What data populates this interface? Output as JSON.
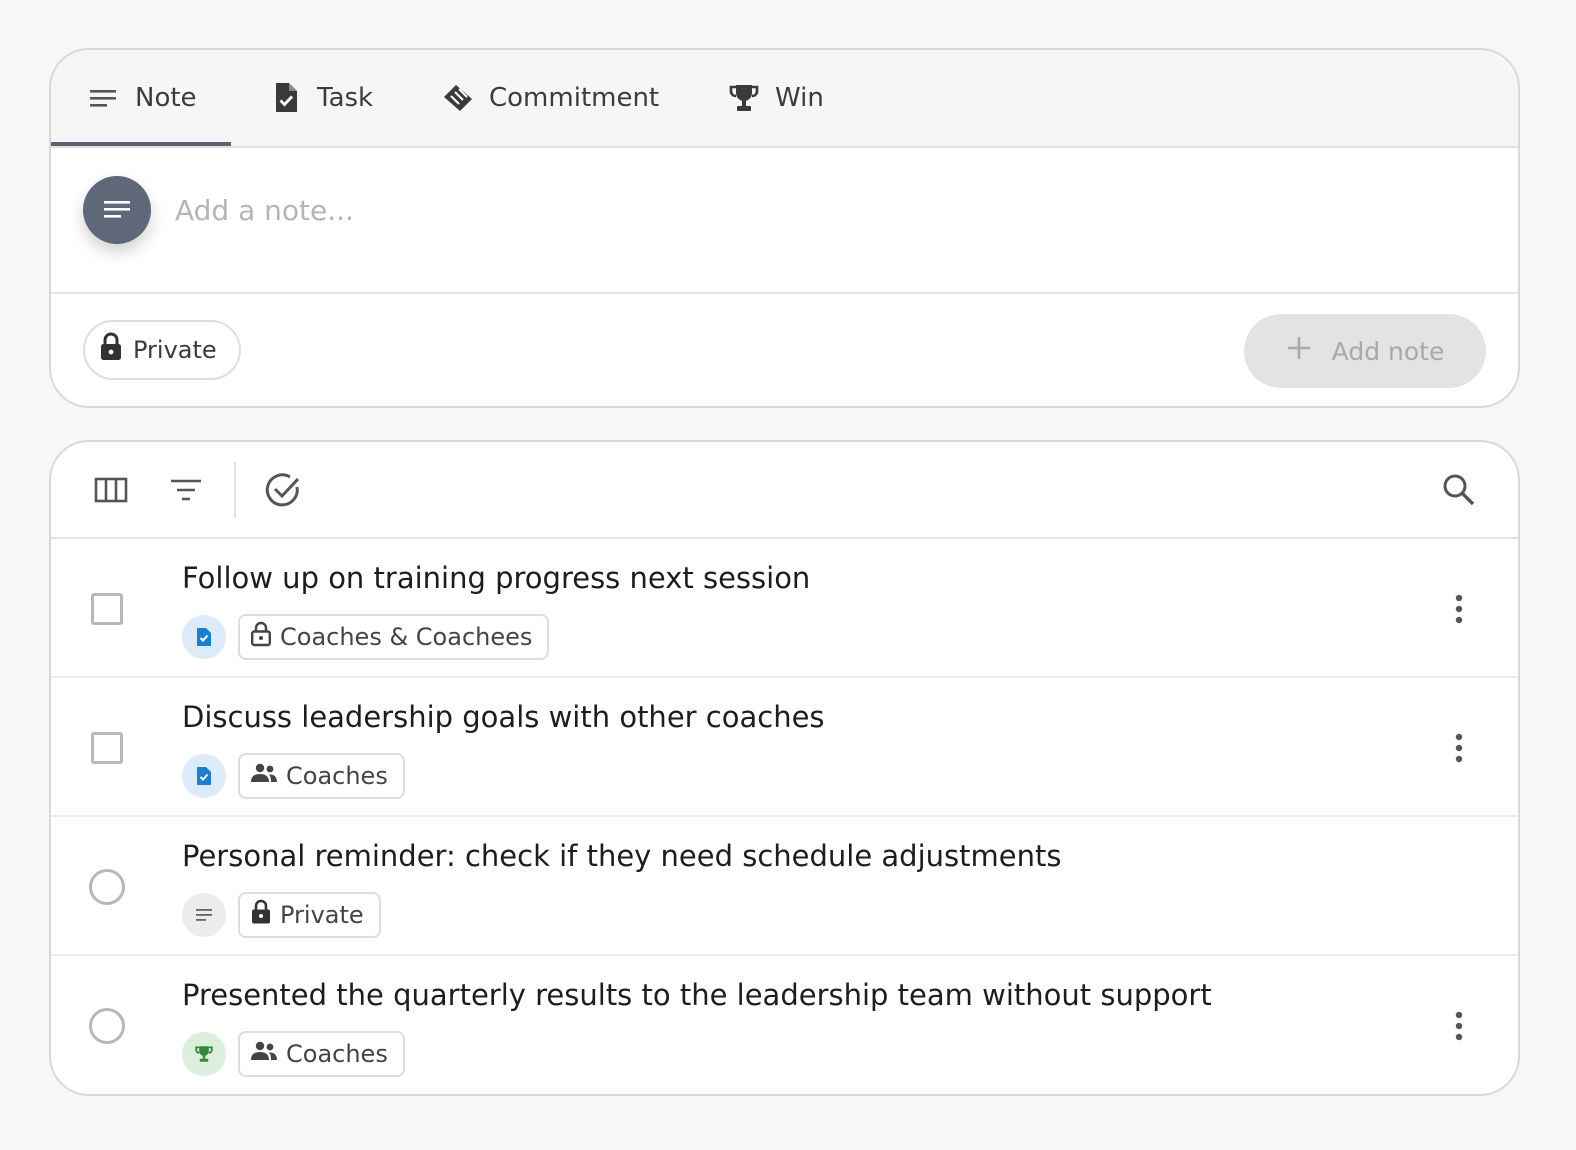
{
  "composer": {
    "tabs": [
      {
        "label": "Note",
        "icon": "note-lines-icon",
        "active": true
      },
      {
        "label": "Task",
        "icon": "task-doc-check-icon"
      },
      {
        "label": "Commitment",
        "icon": "handshake-icon"
      },
      {
        "label": "Win",
        "icon": "trophy-icon"
      }
    ],
    "input_placeholder": "Add a note...",
    "input_value": "",
    "visibility_label": "Private",
    "submit_label": "Add note"
  },
  "list": {
    "toolbar": {
      "icons": [
        "columns-icon",
        "filter-icon",
        "check-circle-icon",
        "search-icon"
      ]
    },
    "items": [
      {
        "title": "Follow up on training progress next session",
        "type": "task",
        "control": "checkbox",
        "visibility": "Coaches & Coachees",
        "visibility_icon": "lock-open-icon"
      },
      {
        "title": "Discuss leadership goals with other coaches",
        "type": "task",
        "control": "checkbox",
        "visibility": "Coaches",
        "visibility_icon": "people-icon"
      },
      {
        "title": "Personal reminder: check if they need schedule adjustments",
        "type": "note",
        "control": "radio",
        "visibility": "Private",
        "visibility_icon": "lock-icon"
      },
      {
        "title": "Presented the quarterly results to the leadership team without support",
        "type": "win",
        "control": "radio",
        "visibility": "Coaches",
        "visibility_icon": "people-icon"
      }
    ]
  },
  "colors": {
    "background": "#f7f7f8",
    "avatar": "#5f6878",
    "task_blue": "#1b7fd1",
    "win_green": "#2e8b3a",
    "disabled_button": "#e3e3e3"
  }
}
